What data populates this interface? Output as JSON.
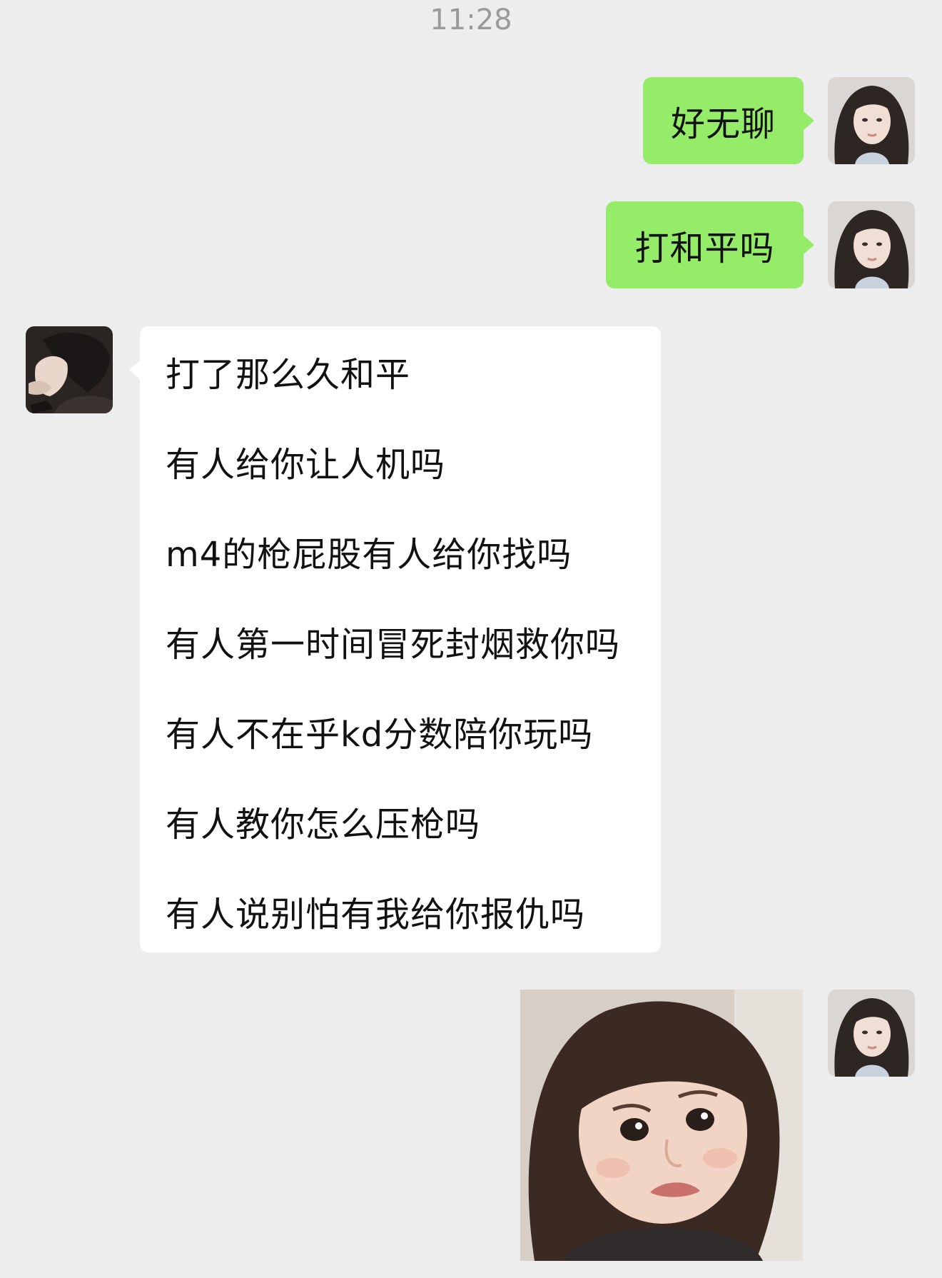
{
  "status": {
    "time": "11:28"
  },
  "messages": [
    {
      "side": "right",
      "type": "text",
      "text": "好无聊"
    },
    {
      "side": "right",
      "type": "text",
      "text": "打和平吗"
    },
    {
      "side": "left",
      "type": "text",
      "lines": [
        "打了那么久和平",
        "有人给你让人机吗",
        "m4的枪屁股有人给你找吗",
        "有人第一时间冒死封烟救你吗",
        "有人不在乎kd分数陪你玩吗",
        "有人教你怎么压枪吗",
        "有人说别怕有我给你报仇吗"
      ]
    },
    {
      "side": "right",
      "type": "sticker",
      "icon": "crying-toddler-sticker"
    }
  ],
  "colors": {
    "background": "#ededed",
    "sent_bubble": "#95ec69",
    "received_bubble": "#ffffff",
    "timestamp": "#9a9a9a"
  }
}
